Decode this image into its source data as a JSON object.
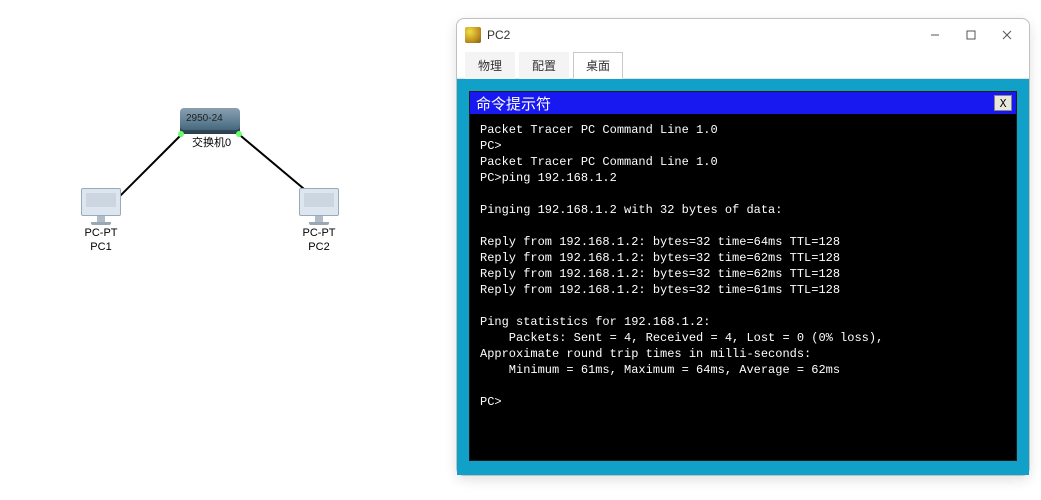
{
  "topology": {
    "switch": {
      "model_overlay": "2950-24",
      "name": "交换机0"
    },
    "pc1": {
      "type": "PC-PT",
      "name": "PC1"
    },
    "pc2": {
      "type": "PC-PT",
      "name": "PC2"
    }
  },
  "window": {
    "title": "PC2",
    "tabs": [
      "物理",
      "配置",
      "桌面"
    ],
    "active_tab_index": 2
  },
  "cmd": {
    "title": "命令提示符",
    "close_label": "X",
    "lines": [
      "Packet Tracer PC Command Line 1.0",
      "PC>",
      "Packet Tracer PC Command Line 1.0",
      "PC>ping 192.168.1.2",
      "",
      "Pinging 192.168.1.2 with 32 bytes of data:",
      "",
      "Reply from 192.168.1.2: bytes=32 time=64ms TTL=128",
      "Reply from 192.168.1.2: bytes=32 time=62ms TTL=128",
      "Reply from 192.168.1.2: bytes=32 time=62ms TTL=128",
      "Reply from 192.168.1.2: bytes=32 time=61ms TTL=128",
      "",
      "Ping statistics for 192.168.1.2:",
      "    Packets: Sent = 4, Received = 4, Lost = 0 (0% loss),",
      "Approximate round trip times in milli-seconds:",
      "    Minimum = 61ms, Maximum = 64ms, Average = 62ms",
      "",
      "PC>"
    ]
  }
}
